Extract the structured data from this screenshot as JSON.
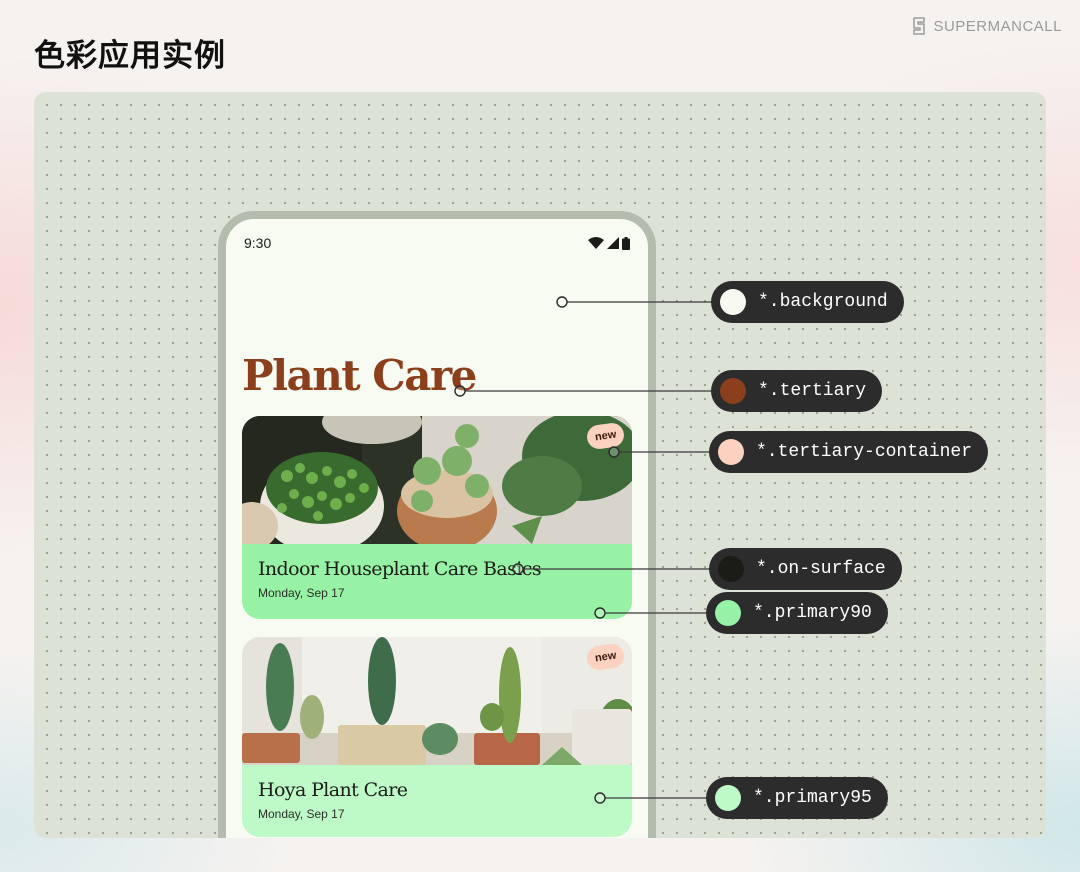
{
  "page": {
    "title": "色彩应用实例",
    "brand": "SUPERMANCALL"
  },
  "phone": {
    "status_time": "9:30",
    "app_title": "Plant Care",
    "cards": [
      {
        "title": "Indoor Houseplant Care Basics",
        "date": "Monday, Sep 17",
        "badge": "new"
      },
      {
        "title": "Hoya Plant Care",
        "date": "Monday, Sep 17",
        "badge": "new"
      }
    ]
  },
  "tokens": [
    {
      "label": "*.background",
      "color": "#f8faf2"
    },
    {
      "label": "*.tertiary",
      "color": "#8b3f1c"
    },
    {
      "label": "*.tertiary-container",
      "color": "#fbd1bf"
    },
    {
      "label": "*.on-surface",
      "color": "#1b1c18"
    },
    {
      "label": "*.primary90",
      "color": "#97f2a6"
    },
    {
      "label": "*.primary95",
      "color": "#bdfac8"
    }
  ],
  "colors": {
    "canvas": "#dde2d6",
    "tertiary": "#8b3f1c",
    "tertiary_container": "#fbd1bf",
    "primary90": "#97f2a6",
    "primary95": "#bdfac8",
    "token_pill": "#2c2c2c"
  }
}
